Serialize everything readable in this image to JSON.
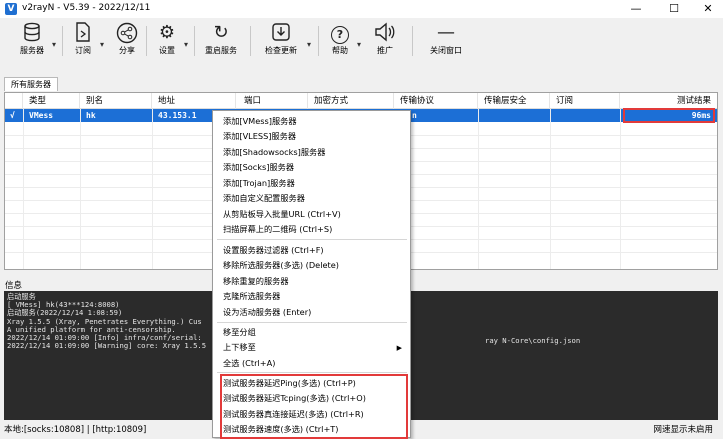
{
  "app": {
    "title": "v2rayN - V5.39 - 2022/12/11",
    "icon": "V"
  },
  "window_controls": {
    "minimize": "—",
    "maximize": "☐",
    "close": "✕"
  },
  "toolbar": {
    "servers": "服务器",
    "subscription": "订阅",
    "share": "分享",
    "settings": "设置",
    "restart": "重启服务",
    "check_update": "检查更新",
    "help": "帮助",
    "promote": "推广",
    "close_window": "关闭窗口"
  },
  "tab": {
    "label": "所有服务器"
  },
  "columns": [
    "类型",
    "别名",
    "地址",
    "端口",
    "加密方式",
    "传输协议",
    "传输层安全",
    "订阅",
    "测试结果"
  ],
  "rows": [
    {
      "check": "√",
      "type": "VMess",
      "alias": "hk",
      "address": "43.153.1",
      "port": "",
      "security": "",
      "network": "n",
      "tls": "",
      "sub": "",
      "result": "96ms"
    }
  ],
  "info_label": "信息",
  "log_lines": [
    "启动服务",
    "[ VMess] hk(43***124:8008)",
    "启动服务(2022/12/14 1:08:59)",
    "Xray 1.5.5 (Xray, Penetrates Everything.) Cus",
    "A unified platform for anti-censorship.",
    "2022/12/14 01:09:00 [Info] infra/conf/serial:",
    "2022/12/14 01:09:00 [Warning] core: Xray 1.5.5"
  ],
  "log_right": "ray N-Core\\config.json",
  "status": {
    "left": "本地:[socks:10808] | [http:10809]",
    "right": "网速显示未启用"
  },
  "context_menu": {
    "group1": [
      "添加[VMess]服务器",
      "添加[VLESS]服务器",
      "添加[Shadowsocks]服务器",
      "添加[Socks]服务器",
      "添加[Trojan]服务器",
      "添加自定义配置服务器",
      "从剪贴板导入批量URL (Ctrl+V)",
      "扫描屏幕上的二维码 (Ctrl+S)"
    ],
    "group2": [
      "设置服务器过滤器 (Ctrl+F)",
      "移除所选服务器(多选) (Delete)",
      "移除重复的服务器",
      "克隆所选服务器",
      "设为活动服务器 (Enter)"
    ],
    "group3": [
      "移至分组",
      "上下移至",
      "全选 (Ctrl+A)"
    ],
    "group4": [
      "测试服务器延迟Ping(多选) (Ctrl+P)",
      "测试服务器延迟Tcping(多选) (Ctrl+O)",
      "测试服务器真连接延迟(多选) (Ctrl+R)",
      "测试服务器速度(多选) (Ctrl+T)"
    ]
  },
  "colors": {
    "selection": "#1c6fd6",
    "highlight": "#e23a3a",
    "log_bg": "#2b2b2b"
  }
}
